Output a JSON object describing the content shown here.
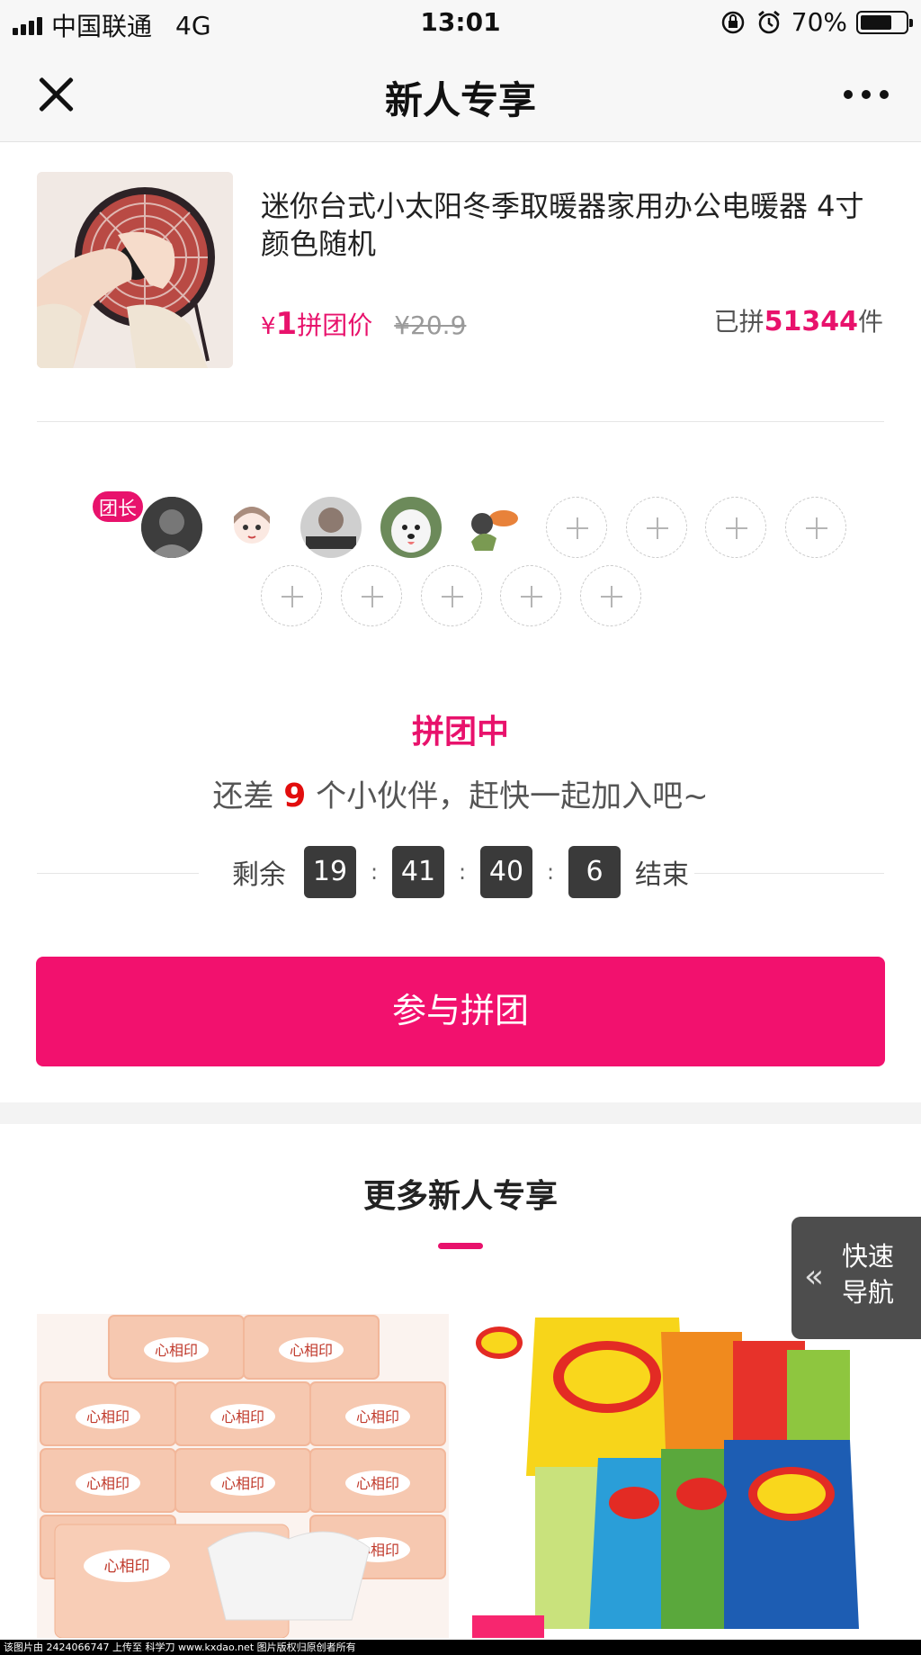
{
  "status_bar": {
    "carrier": "中国联通",
    "network": "4G",
    "time": "13:01",
    "battery": "70%",
    "battery_level": 0.7
  },
  "nav": {
    "title": "新人专享",
    "close_icon": "close-icon",
    "more_icon": "more-icon"
  },
  "product": {
    "title": "迷你台式小太阳冬季取暖器家用办公电暖器 4寸颜色随机",
    "price_symbol": "¥",
    "price": "1",
    "price_label": "拼团价",
    "original_price": "¥20.9",
    "sold_prefix": "已拼",
    "sold_count": "51344",
    "sold_suffix": "件"
  },
  "group": {
    "leader_badge": "团长",
    "status": "拼团中",
    "tip_prefix": "还差",
    "remaining": "9",
    "tip_suffix": "个小伙伴，赶快一起加入吧~",
    "member_count": 5,
    "empty_slots": 9
  },
  "countdown": {
    "prefix": "剩余",
    "hours": "19",
    "minutes": "41",
    "seconds": "40",
    "tenths": "6",
    "separator": ":",
    "suffix": "结束"
  },
  "join_button": "参与拼团",
  "more_section": {
    "title": "更多新人专享"
  },
  "quick_nav": {
    "label_line1": "快速",
    "label_line2": "导航",
    "icon": "double-chevron-left-icon"
  },
  "footer": "该图片由 2424066747 上传至 科学刀 www.kxdao.net 图片版权归原创者所有",
  "colors": {
    "accent": "#e8126c",
    "button": "#f2116e",
    "countdown_box": "#3a3a3a"
  }
}
